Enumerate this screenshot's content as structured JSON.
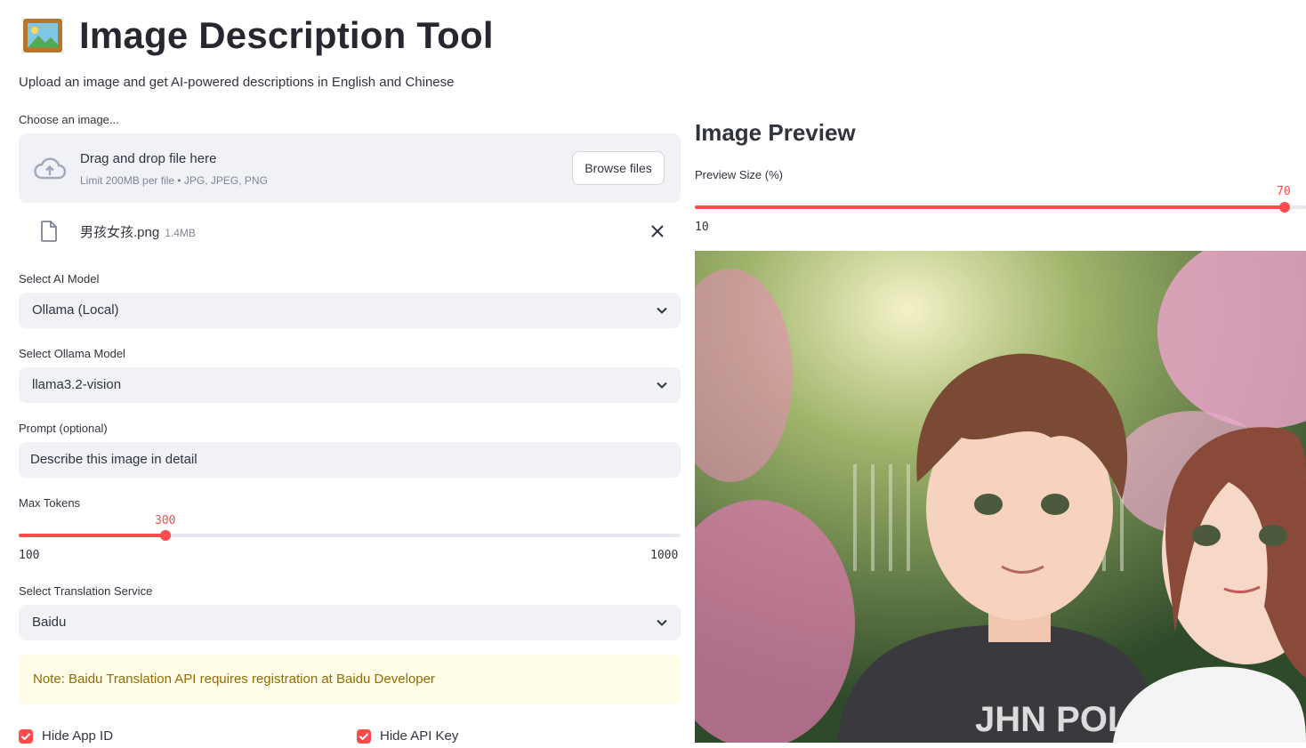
{
  "header": {
    "title": "Image Description Tool",
    "subtitle": "Upload an image and get AI-powered descriptions in English and Chinese"
  },
  "uploader": {
    "label": "Choose an image...",
    "drop_text": "Drag and drop file here",
    "limit_text": "Limit 200MB per file • JPG, JPEG, PNG",
    "browse_label": "Browse files",
    "file": {
      "name": "男孩女孩.png",
      "size": "1.4MB"
    }
  },
  "ai_model": {
    "label": "Select AI Model",
    "value": "Ollama (Local)"
  },
  "ollama_model": {
    "label": "Select Ollama Model",
    "value": "llama3.2-vision"
  },
  "prompt": {
    "label": "Prompt (optional)",
    "value": "Describe this image in detail"
  },
  "max_tokens": {
    "label": "Max Tokens",
    "value": "300",
    "min": "100",
    "max": "1000",
    "fraction": 0.2222
  },
  "translation": {
    "label": "Select Translation Service",
    "value": "Baidu"
  },
  "note": "Note: Baidu Translation API requires registration at Baidu Developer",
  "checkboxes": {
    "hide_app_id": "Hide App ID",
    "hide_api_key": "Hide API Key"
  },
  "preview": {
    "title": "Image Preview",
    "size_label": "Preview Size (%)",
    "size_value": "70",
    "size_min": "10",
    "overlay_text": "JHN POL"
  },
  "colors": {
    "accent": "#ff4b4b",
    "widget_bg": "#f0f2f6",
    "note_bg": "#fffce7",
    "note_text": "#926c05"
  },
  "icons": [
    "framed-picture-icon",
    "cloud-upload-icon",
    "file-icon",
    "close-icon",
    "chevron-down-icon",
    "checkbox-checked-icon"
  ]
}
